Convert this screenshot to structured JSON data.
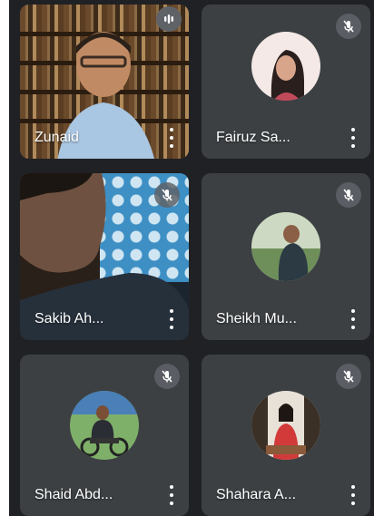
{
  "participants": [
    {
      "name": "Zunaid",
      "muted": false,
      "speaking": true,
      "has_video": true
    },
    {
      "name": "Fairuz  Sa...",
      "muted": true,
      "speaking": false,
      "has_video": false,
      "avatar_colors": [
        "#f4e9e6",
        "#2a1f1c",
        "#c04a5a"
      ]
    },
    {
      "name": "Sakib  Ah...",
      "muted": true,
      "speaking": false,
      "has_video": true
    },
    {
      "name": "Sheikh Mu...",
      "muted": true,
      "speaking": false,
      "has_video": false,
      "avatar_colors": [
        "#6f8f5a",
        "#2c3a44",
        "#cdd9c2"
      ]
    },
    {
      "name": "Shaid  Abd...",
      "muted": true,
      "speaking": false,
      "has_video": false,
      "avatar_colors": [
        "#7fb06a",
        "#2b2d35",
        "#4a7fb8"
      ]
    },
    {
      "name": "Shahara A...",
      "muted": true,
      "speaking": false,
      "has_video": false,
      "avatar_colors": [
        "#3a3026",
        "#e8e1d8",
        "#d23a3a"
      ]
    }
  ],
  "colors": {
    "background": "#202124",
    "tile": "#3c4043",
    "mute_badge": "#5f6368",
    "text": "#ffffff"
  }
}
